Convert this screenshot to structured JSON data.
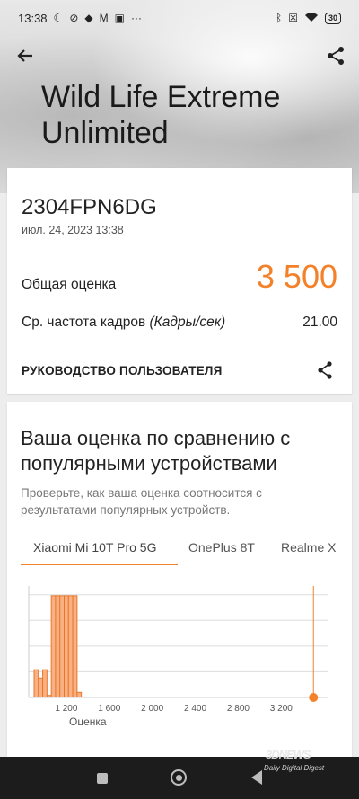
{
  "status_bar": {
    "time": "13:38",
    "left_icons": [
      "moon-icon",
      "vpn-off-icon",
      "app-icon",
      "mail-icon",
      "calendar-icon"
    ],
    "more": "···",
    "battery": "30",
    "right_icons": [
      "bluetooth-icon",
      "sim-off-icon",
      "wifi-icon",
      "battery-icon"
    ]
  },
  "header": {
    "title": "Wild Life Extreme Unlimited"
  },
  "result": {
    "device": "2304FPN6DG",
    "date": "июл. 24, 2023 13:38",
    "score_label": "Общая оценка",
    "score_value": "3 500",
    "fps_label": "Ср. частота кадров",
    "fps_unit": "(Кадры/сек)",
    "fps_value": "21.00",
    "guide_label": "РУКОВОДСТВО ПОЛЬЗОВАТЕЛЯ"
  },
  "comparison": {
    "title": "Ваша оценка по сравнению с популярными устройствами",
    "description": "Проверьте, как ваша оценка соотносится с результатами популярных устройств.",
    "tabs": [
      "Xiaomi Mi 10T Pro 5G",
      "OnePlus 8T",
      "Realme X"
    ],
    "active_tab": 0
  },
  "colors": {
    "accent": "#f3812a",
    "bar_fill": "#f9b184",
    "bar_stroke": "#e8772b",
    "grid": "#dddddd"
  },
  "chart_data": {
    "type": "bar",
    "xlabel": "Оценка",
    "tick_labels": [
      "1 200",
      "1 600",
      "2 000",
      "2 400",
      "2 800",
      "3 200"
    ],
    "x": [
      900,
      940,
      980,
      1020,
      1060,
      1100,
      1140,
      1180,
      1220,
      1260,
      1300
    ],
    "values": [
      0.27,
      0.19,
      0.27,
      0.02,
      0.99,
      0.99,
      0.99,
      0.99,
      0.99,
      0.99,
      0.05
    ],
    "xlim": [
      850,
      3640
    ],
    "ylim": [
      0,
      1.05
    ],
    "marker_score": 3500
  },
  "watermark": {
    "main": "3D",
    "suffix": "NEWS",
    "sub": "Daily Digital Digest"
  }
}
